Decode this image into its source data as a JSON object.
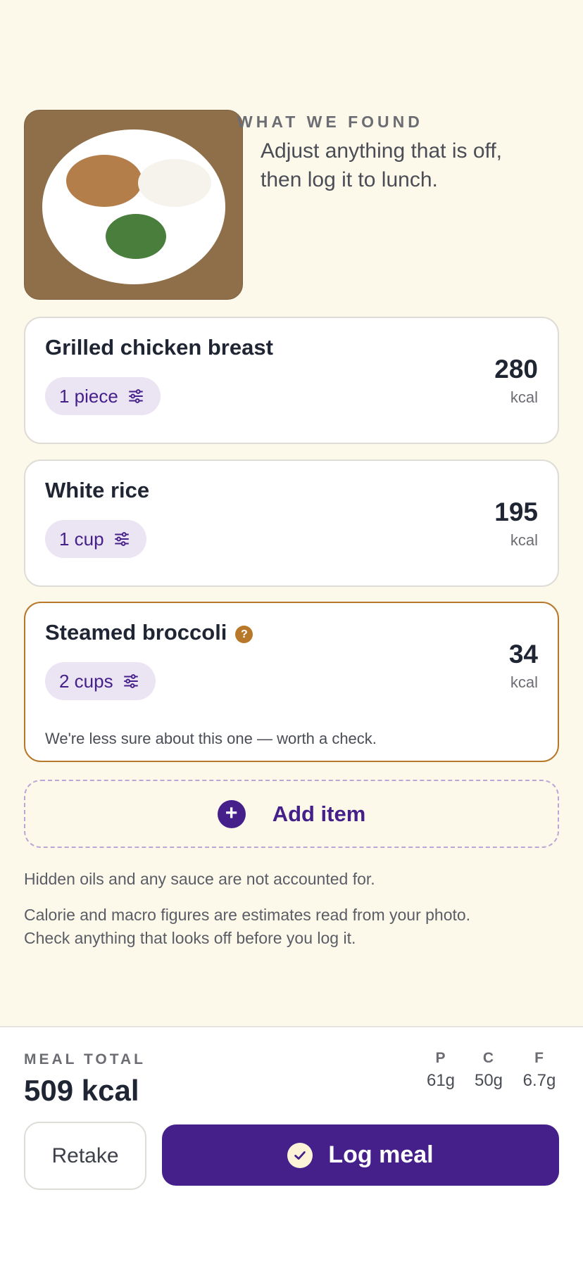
{
  "header": {
    "eyebrow": "WHAT WE FOUND",
    "line1": "Adjust anything that is off,",
    "line2": "then log it to lunch."
  },
  "items": [
    {
      "name": "Grilled chicken breast",
      "portion": "1 piece",
      "kcal": "280",
      "unit": "kcal"
    },
    {
      "name": "White rice",
      "portion": "1 cup",
      "kcal": "195",
      "unit": "kcal"
    },
    {
      "name": "Steamed broccoli",
      "portion": "2 cups",
      "kcal": "34",
      "unit": "kcal",
      "flag_icon": "question-icon",
      "flag_symbol": "?",
      "note": "We're less sure about this one — worth a check."
    }
  ],
  "add_item": {
    "label": "Add item",
    "icon": "plus-icon",
    "symbol": "+"
  },
  "disclaimer": {
    "oils": "Hidden oils and any sauce are not accounted for.",
    "estimate_line1": "Calorie and macro figures are estimates read from your photo.",
    "estimate_line2": "Check anything that looks off before you log it."
  },
  "footer": {
    "meal_total_label": "MEAL TOTAL",
    "meal_total_value": "509 kcal",
    "macros": [
      {
        "label": "P",
        "value": "61g"
      },
      {
        "label": "C",
        "value": "50g"
      },
      {
        "label": "F",
        "value": "6.7g"
      }
    ],
    "retake_label": "Retake",
    "log_label": "Log meal"
  },
  "colors": {
    "background": "#fdf9ea",
    "accent": "#45208a",
    "warning": "#b8782a",
    "chip": "#ebe4f3"
  }
}
